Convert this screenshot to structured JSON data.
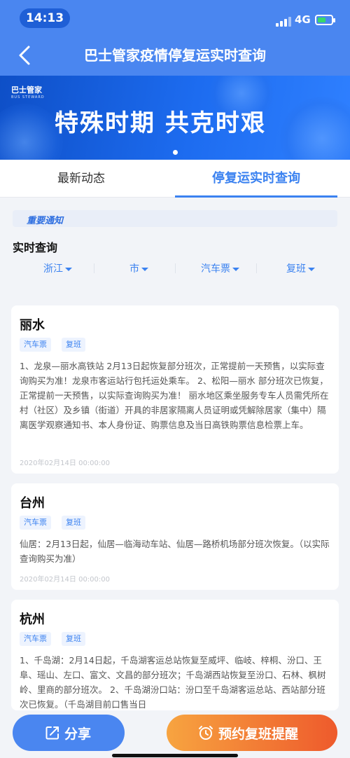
{
  "status_bar": {
    "time": "14:13",
    "network": "4G"
  },
  "nav": {
    "title": "巴士管家疫情停复运实时查询"
  },
  "banner": {
    "logo_text": "巴士管家",
    "logo_subtext": "BUS STEWARD",
    "slogan": "特殊时期 共克时艰"
  },
  "tabs": [
    {
      "label": "最新动态",
      "active": false
    },
    {
      "label": "停复运实时查询",
      "active": true
    }
  ],
  "notice": {
    "label": "重要通知"
  },
  "query": {
    "title": "实时查询",
    "filters": [
      {
        "label": "浙江"
      },
      {
        "label": "市"
      },
      {
        "label": "汽车票"
      },
      {
        "label": "复班"
      }
    ]
  },
  "cards": [
    {
      "city": "丽水",
      "tags": [
        "汽车票",
        "复班"
      ],
      "body": "1、龙泉—丽水高铁站 2月13日起恢复部分班次，正常提前一天预售，以实际查询购买为准！龙泉市客运站行包托运处乘车。 2、松阳—丽水 部分班次已恢复，正常提前一天预售，以实际查询购买为准！ 丽水地区乘坐服务专车人员需凭所在村（社区）及乡镇（街道）开具的非居家隔离人员证明或凭解除居家（集中）隔离医学观察通知书、本人身份证、购票信息及当日高铁购票信息检票上车。",
      "date": "2020年02月14日 00:00:00"
    },
    {
      "city": "台州",
      "tags": [
        "汽车票",
        "复班"
      ],
      "body": "仙居：2月13日起，仙居—临海动车站、仙居—路桥机场部分班次恢复。（以实际查询购买为准）",
      "date": "2020年02月14日 00:00:00"
    },
    {
      "city": "杭州",
      "tags": [
        "汽车票",
        "复班"
      ],
      "body": "1、千岛湖：2月14日起，千岛湖客运总站恢复至威坪、临岐、梓桐、汾口、王阜、瑶山、左口、富文、文昌的部分班次；千岛湖西站恢复至汾口、石林、枫树岭、里商的部分班次。 2、千岛湖汾口站：汾口至千岛湖客运总站、西站部分班次已恢复。（千岛湖目前口售当日",
      "date": ""
    }
  ],
  "bottom": {
    "share_label": "分享",
    "remind_label": "预约复班提醒"
  },
  "colors": {
    "primary": "#4a86f0",
    "accent_orange": "#ee5a2c",
    "tag_bg": "#edf3fe"
  }
}
